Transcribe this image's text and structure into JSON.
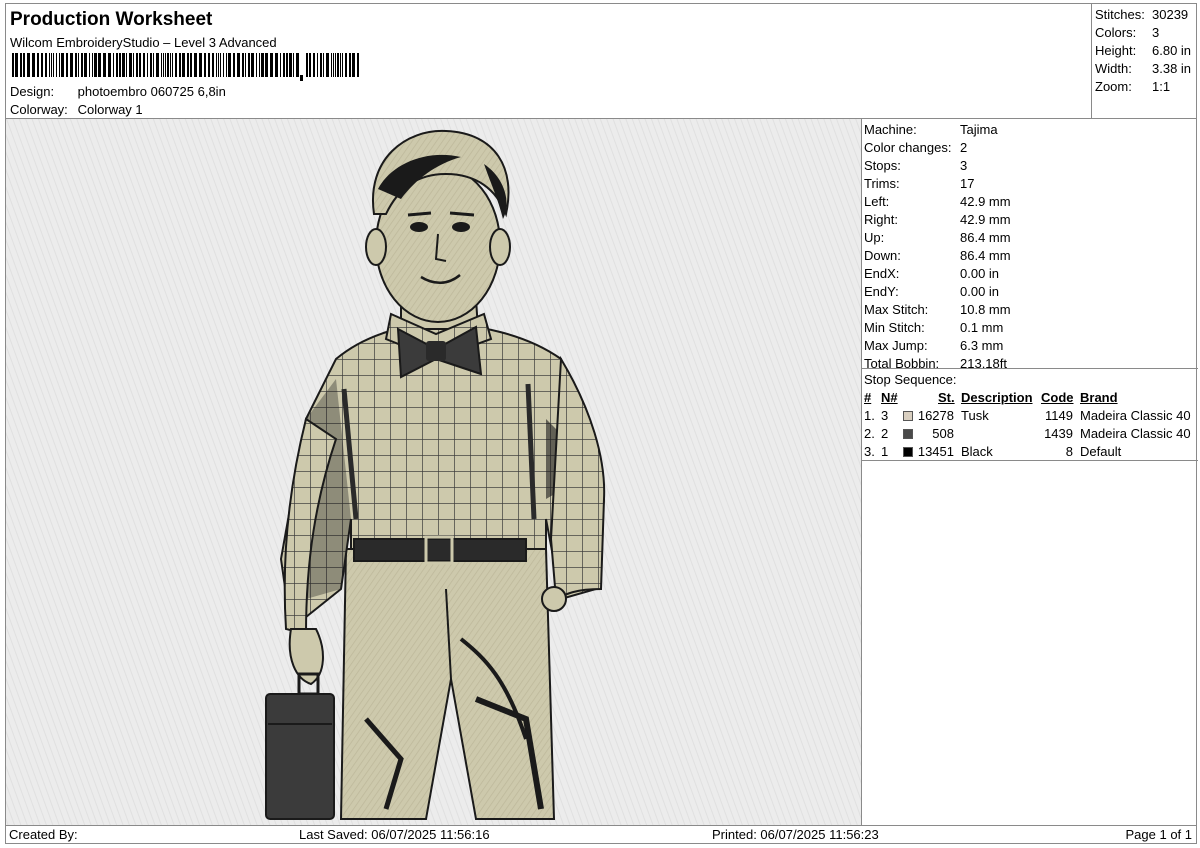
{
  "header": {
    "title": "Production Worksheet",
    "software": "Wilcom EmbroideryStudio – Level 3 Advanced",
    "design_label": "Design:",
    "design_value": "photoembro 060725 6,8in",
    "colorway_label": "Colorway:",
    "colorway_value": "Colorway 1"
  },
  "summary": {
    "stitches_label": "Stitches:",
    "stitches_value": "30239",
    "colors_label": "Colors:",
    "colors_value": "3",
    "height_label": "Height:",
    "height_value": "6.80 in",
    "width_label": "Width:",
    "width_value": "3.38 in",
    "zoom_label": "Zoom:",
    "zoom_value": "1:1"
  },
  "machine_info": [
    {
      "label": "Machine:",
      "value": "Tajima"
    },
    {
      "label": "Color changes:",
      "value": "2"
    },
    {
      "label": "Stops:",
      "value": "3"
    },
    {
      "label": "Trims:",
      "value": "17"
    },
    {
      "label": "Left:",
      "value": "42.9 mm"
    },
    {
      "label": "Right:",
      "value": "42.9 mm"
    },
    {
      "label": "Up:",
      "value": "86.4 mm"
    },
    {
      "label": "Down:",
      "value": "86.4 mm"
    },
    {
      "label": "EndX:",
      "value": "0.00 in"
    },
    {
      "label": "EndY:",
      "value": "0.00 in"
    },
    {
      "label": "Max Stitch:",
      "value": "10.8 mm"
    },
    {
      "label": "Min Stitch:",
      "value": "0.1 mm"
    },
    {
      "label": "Max Jump:",
      "value": "6.3 mm"
    },
    {
      "label": "Total Bobbin:",
      "value": "213.18ft"
    }
  ],
  "stop_sequence": {
    "title": "Stop Sequence:",
    "columns": {
      "num": "#",
      "needle": "N#",
      "stitches": "St.",
      "description": "Description",
      "code": "Code",
      "brand": "Brand"
    },
    "rows": [
      {
        "num": "1.",
        "needle": "3",
        "color": "#d9cfc0",
        "stitches": "16278",
        "description": "Tusk",
        "code": "1149",
        "brand": "Madeira Classic 40"
      },
      {
        "num": "2.",
        "needle": "2",
        "color": "#4a4a4a",
        "stitches": "508",
        "description": "",
        "code": "1439",
        "brand": "Madeira Classic 40"
      },
      {
        "num": "3.",
        "needle": "1",
        "color": "#000000",
        "stitches": "13451",
        "description": "Black",
        "code": "8",
        "brand": "Default"
      }
    ]
  },
  "footer": {
    "created_by": "Created By:",
    "last_saved": "Last Saved: 06/07/2025 11:56:16",
    "printed": "Printed: 06/07/2025 11:56:23",
    "page": "Page 1 of 1"
  },
  "preview": {
    "subject": "embroidered boy in plaid shirt with bow tie, belt and suitcase",
    "colors": {
      "tusk": "#cdc9ac",
      "dark": "#3b3b3b",
      "black": "#1a1a1a",
      "background": "#ececec"
    }
  }
}
